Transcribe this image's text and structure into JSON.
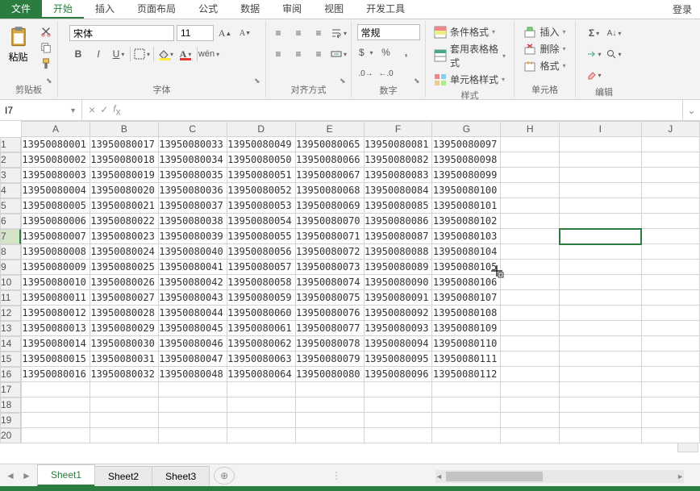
{
  "tabs": {
    "file": "文件",
    "home": "开始",
    "insert": "插入",
    "layout": "页面布局",
    "formula": "公式",
    "data": "数据",
    "review": "审阅",
    "view": "视图",
    "dev": "开发工具"
  },
  "login": "登录",
  "ribbon": {
    "clipboard": {
      "paste": "粘贴",
      "label": "剪贴板"
    },
    "font": {
      "name": "宋体",
      "size": "11",
      "label": "字体",
      "wen": "wén"
    },
    "align": {
      "label": "对齐方式"
    },
    "number": {
      "format": "常规",
      "label": "数字"
    },
    "styles": {
      "cond": "条件格式",
      "table": "套用表格格式",
      "cell": "单元格样式",
      "label": "样式"
    },
    "cells": {
      "insert": "插入",
      "delete": "删除",
      "format": "格式",
      "label": "单元格"
    },
    "edit": {
      "label": "编辑"
    }
  },
  "namebox": "I7",
  "cols": [
    "A",
    "B",
    "C",
    "D",
    "E",
    "F",
    "G",
    "H",
    "I",
    "J"
  ],
  "rows": [
    1,
    2,
    3,
    4,
    5,
    6,
    7,
    8,
    9,
    10,
    11,
    12,
    13,
    14,
    15,
    16,
    17,
    18,
    19,
    20
  ],
  "data": [
    [
      "13950080001",
      "13950080017",
      "13950080033",
      "13950080049",
      "13950080065",
      "13950080081",
      "13950080097"
    ],
    [
      "13950080002",
      "13950080018",
      "13950080034",
      "13950080050",
      "13950080066",
      "13950080082",
      "13950080098"
    ],
    [
      "13950080003",
      "13950080019",
      "13950080035",
      "13950080051",
      "13950080067",
      "13950080083",
      "13950080099"
    ],
    [
      "13950080004",
      "13950080020",
      "13950080036",
      "13950080052",
      "13950080068",
      "13950080084",
      "13950080100"
    ],
    [
      "13950080005",
      "13950080021",
      "13950080037",
      "13950080053",
      "13950080069",
      "13950080085",
      "13950080101"
    ],
    [
      "13950080006",
      "13950080022",
      "13950080038",
      "13950080054",
      "13950080070",
      "13950080086",
      "13950080102"
    ],
    [
      "13950080007",
      "13950080023",
      "13950080039",
      "13950080055",
      "13950080071",
      "13950080087",
      "13950080103"
    ],
    [
      "13950080008",
      "13950080024",
      "13950080040",
      "13950080056",
      "13950080072",
      "13950080088",
      "13950080104"
    ],
    [
      "13950080009",
      "13950080025",
      "13950080041",
      "13950080057",
      "13950080073",
      "13950080089",
      "13950080105"
    ],
    [
      "13950080010",
      "13950080026",
      "13950080042",
      "13950080058",
      "13950080074",
      "13950080090",
      "13950080106"
    ],
    [
      "13950080011",
      "13950080027",
      "13950080043",
      "13950080059",
      "13950080075",
      "13950080091",
      "13950080107"
    ],
    [
      "13950080012",
      "13950080028",
      "13950080044",
      "13950080060",
      "13950080076",
      "13950080092",
      "13950080108"
    ],
    [
      "13950080013",
      "13950080029",
      "13950080045",
      "13950080061",
      "13950080077",
      "13950080093",
      "13950080109"
    ],
    [
      "13950080014",
      "13950080030",
      "13950080046",
      "13950080062",
      "13950080078",
      "13950080094",
      "13950080110"
    ],
    [
      "13950080015",
      "13950080031",
      "13950080047",
      "13950080063",
      "13950080079",
      "13950080095",
      "13950080111"
    ],
    [
      "13950080016",
      "13950080032",
      "13950080048",
      "13950080064",
      "13950080080",
      "13950080096",
      "13950080112"
    ]
  ],
  "sheets": [
    "Sheet1",
    "Sheet2",
    "Sheet3"
  ],
  "active_sheet": 0,
  "selected": {
    "row": 7,
    "col": "I"
  }
}
